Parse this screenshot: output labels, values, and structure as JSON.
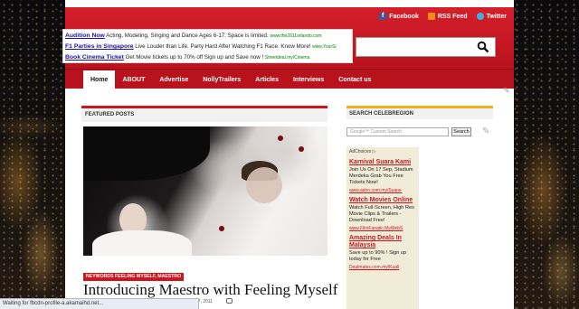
{
  "header": {
    "social": [
      {
        "label": "Facebook",
        "icon": "facebook-icon"
      },
      {
        "label": "RSS Feed",
        "icon": "rss-icon"
      },
      {
        "label": "Twitter",
        "icon": "twitter-icon"
      }
    ]
  },
  "ads": [
    {
      "title": "Audition Now",
      "text": " Acting, Modeling, Singing and Dance Ages 6-17. Space is limited. ",
      "url": "www.the2011orlando.com"
    },
    {
      "title": "F1 Parties in Singapore",
      "text": " Live Louder than Life. Party Hard After Watching F1 Race. Know More! ",
      "url": "www.YourSi"
    },
    {
      "title": "Book Cinema Ticket",
      "text": " Get Movie tickets up to 70% off Sign up and Save now ! ",
      "url": "Streetdeal.my/Cinema"
    }
  ],
  "nav": {
    "items": [
      "Home",
      "ABOUT",
      "Advertise",
      "NollyTrailers",
      "Articles",
      "Interviews",
      "Contact us"
    ],
    "active": "Home"
  },
  "featured": {
    "header": "FEATURED POSTS",
    "tag": "NEYWORDS FEELING MYSELF, MAESTRO",
    "title": "Introducing Maestro with Feeling Myself",
    "date": "R 17, 2011"
  },
  "sidebar": {
    "header": "SEARCH CELEBREGION",
    "search_placeholder": "Google™ Custom Search",
    "search_button": "Search",
    "adchoices": "AdChoices ▷",
    "ads": [
      {
        "title": "Karnival Suara Kami",
        "body": "Join Us On 17 Sep, Stadium Merdeka Grab You Free Tickets Now!",
        "link": "www.astro.com.my/Suara-"
      },
      {
        "title": "Watch Movies Online",
        "body": "Watch Full-Screen, High Res Movie Clips & Trailers - Download Free!",
        "link": "www.FilmFanatic.MyWebS"
      },
      {
        "title": "Amazing Deals In Malaysia",
        "body": "Save up to 90% ! Sign up today for Free",
        "link": "Dealmates.com.my/Kuali"
      }
    ]
  },
  "status": {
    "text": "Waiting for fbcdn-profile-a.akamaihd.net..."
  },
  "colors": {
    "brand_red": "#c9161f",
    "sidebar_accent": "#f2b01e"
  }
}
